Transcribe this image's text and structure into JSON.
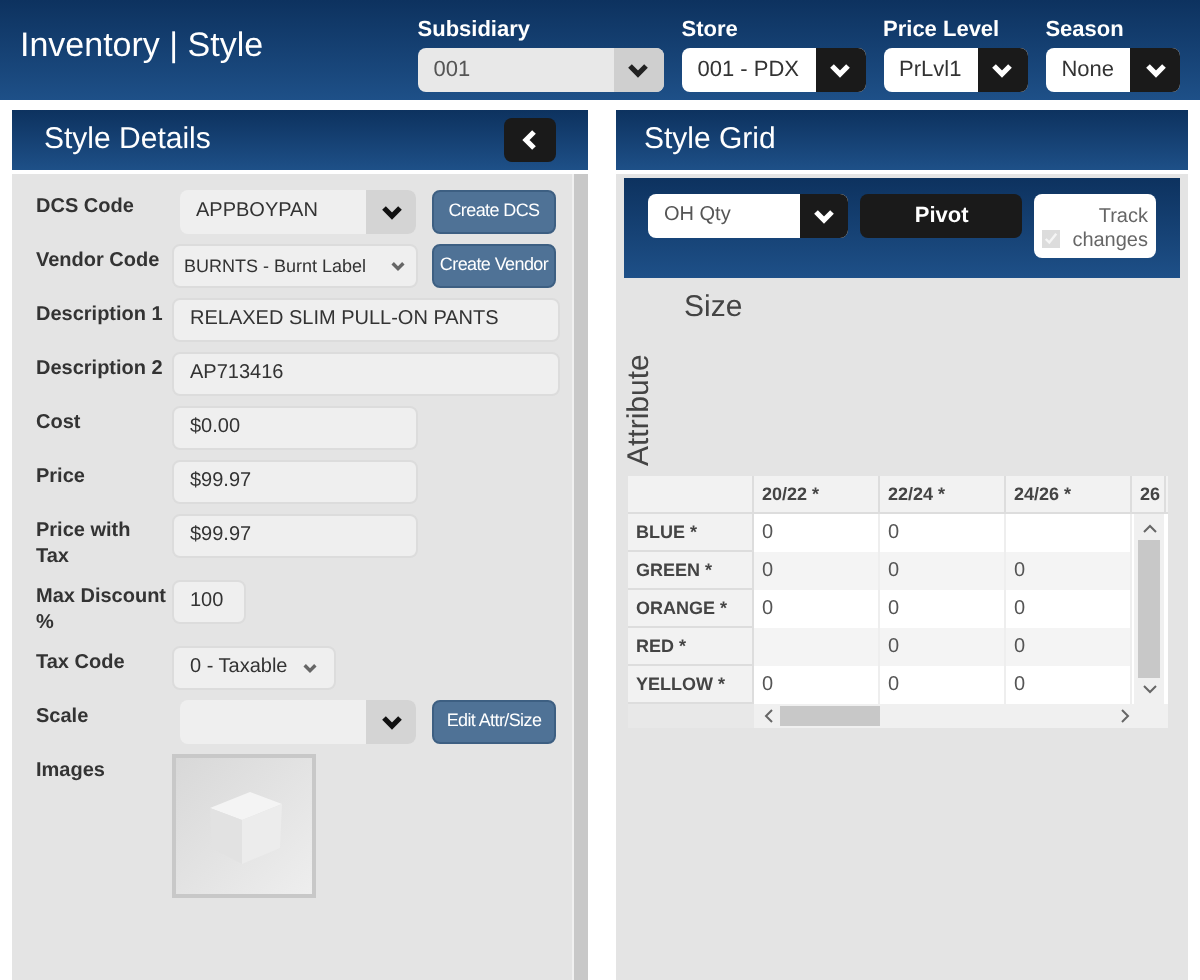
{
  "header": {
    "title": "Inventory | Style",
    "filters": [
      {
        "label": "Subsidiary",
        "value": "001",
        "kind": "light"
      },
      {
        "label": "Store",
        "value": "001 - PDX",
        "kind": "dark"
      },
      {
        "label": "Price Level",
        "value": "PrLvl1",
        "kind": "dark"
      },
      {
        "label": "Season",
        "value": "None",
        "kind": "dark"
      }
    ]
  },
  "style_details": {
    "title": "Style Details",
    "fields": [
      {
        "label": "DCS Code",
        "kind": "combo",
        "value": "APPBOYPAN",
        "button": "Create DCS"
      },
      {
        "label": "Vendor Code",
        "kind": "select",
        "value": "BURNTS - Burnt Label",
        "button": "Create Vendor"
      },
      {
        "label": "Description 1",
        "kind": "wide",
        "value": "RELAXED SLIM PULL-ON PANTS"
      },
      {
        "label": "Description 2",
        "kind": "wide",
        "value": "AP713416"
      },
      {
        "label": "Cost",
        "kind": "medium",
        "value": "$0.00"
      },
      {
        "label": "Price",
        "kind": "medium",
        "value": "$99.97"
      },
      {
        "label": "Price with Tax",
        "kind": "medium",
        "value": "$99.97"
      },
      {
        "label": "Max Discount %",
        "kind": "short",
        "value": "100"
      },
      {
        "label": "Tax Code",
        "kind": "select-short",
        "value": "0 - Taxable"
      },
      {
        "label": "Scale",
        "kind": "combo",
        "button": "Edit Attr/Size"
      },
      {
        "label": "Images",
        "kind": "image"
      }
    ]
  },
  "style_grid": {
    "title": "Style Grid",
    "measure": "OH Qty",
    "pivot": "Pivot",
    "track_changes": {
      "label": "Track changes",
      "checked": true,
      "disabled": true
    },
    "column_axis": "Size",
    "row_axis": "Attribute",
    "table": {
      "columns": [
        "20/22 *",
        "22/24 *",
        "24/26 *",
        "26"
      ],
      "rows": [
        {
          "label": "BLUE *",
          "cells": [
            "0",
            "0",
            null
          ]
        },
        {
          "label": "GREEN *",
          "cells": [
            "0",
            "0",
            "0"
          ]
        },
        {
          "label": "ORANGE *",
          "cells": [
            "0",
            "0",
            "0"
          ]
        },
        {
          "label": "RED *",
          "cells": [
            null,
            "0",
            "0"
          ]
        },
        {
          "label": "YELLOW *",
          "cells": [
            "0",
            "0",
            "0"
          ]
        }
      ]
    }
  }
}
